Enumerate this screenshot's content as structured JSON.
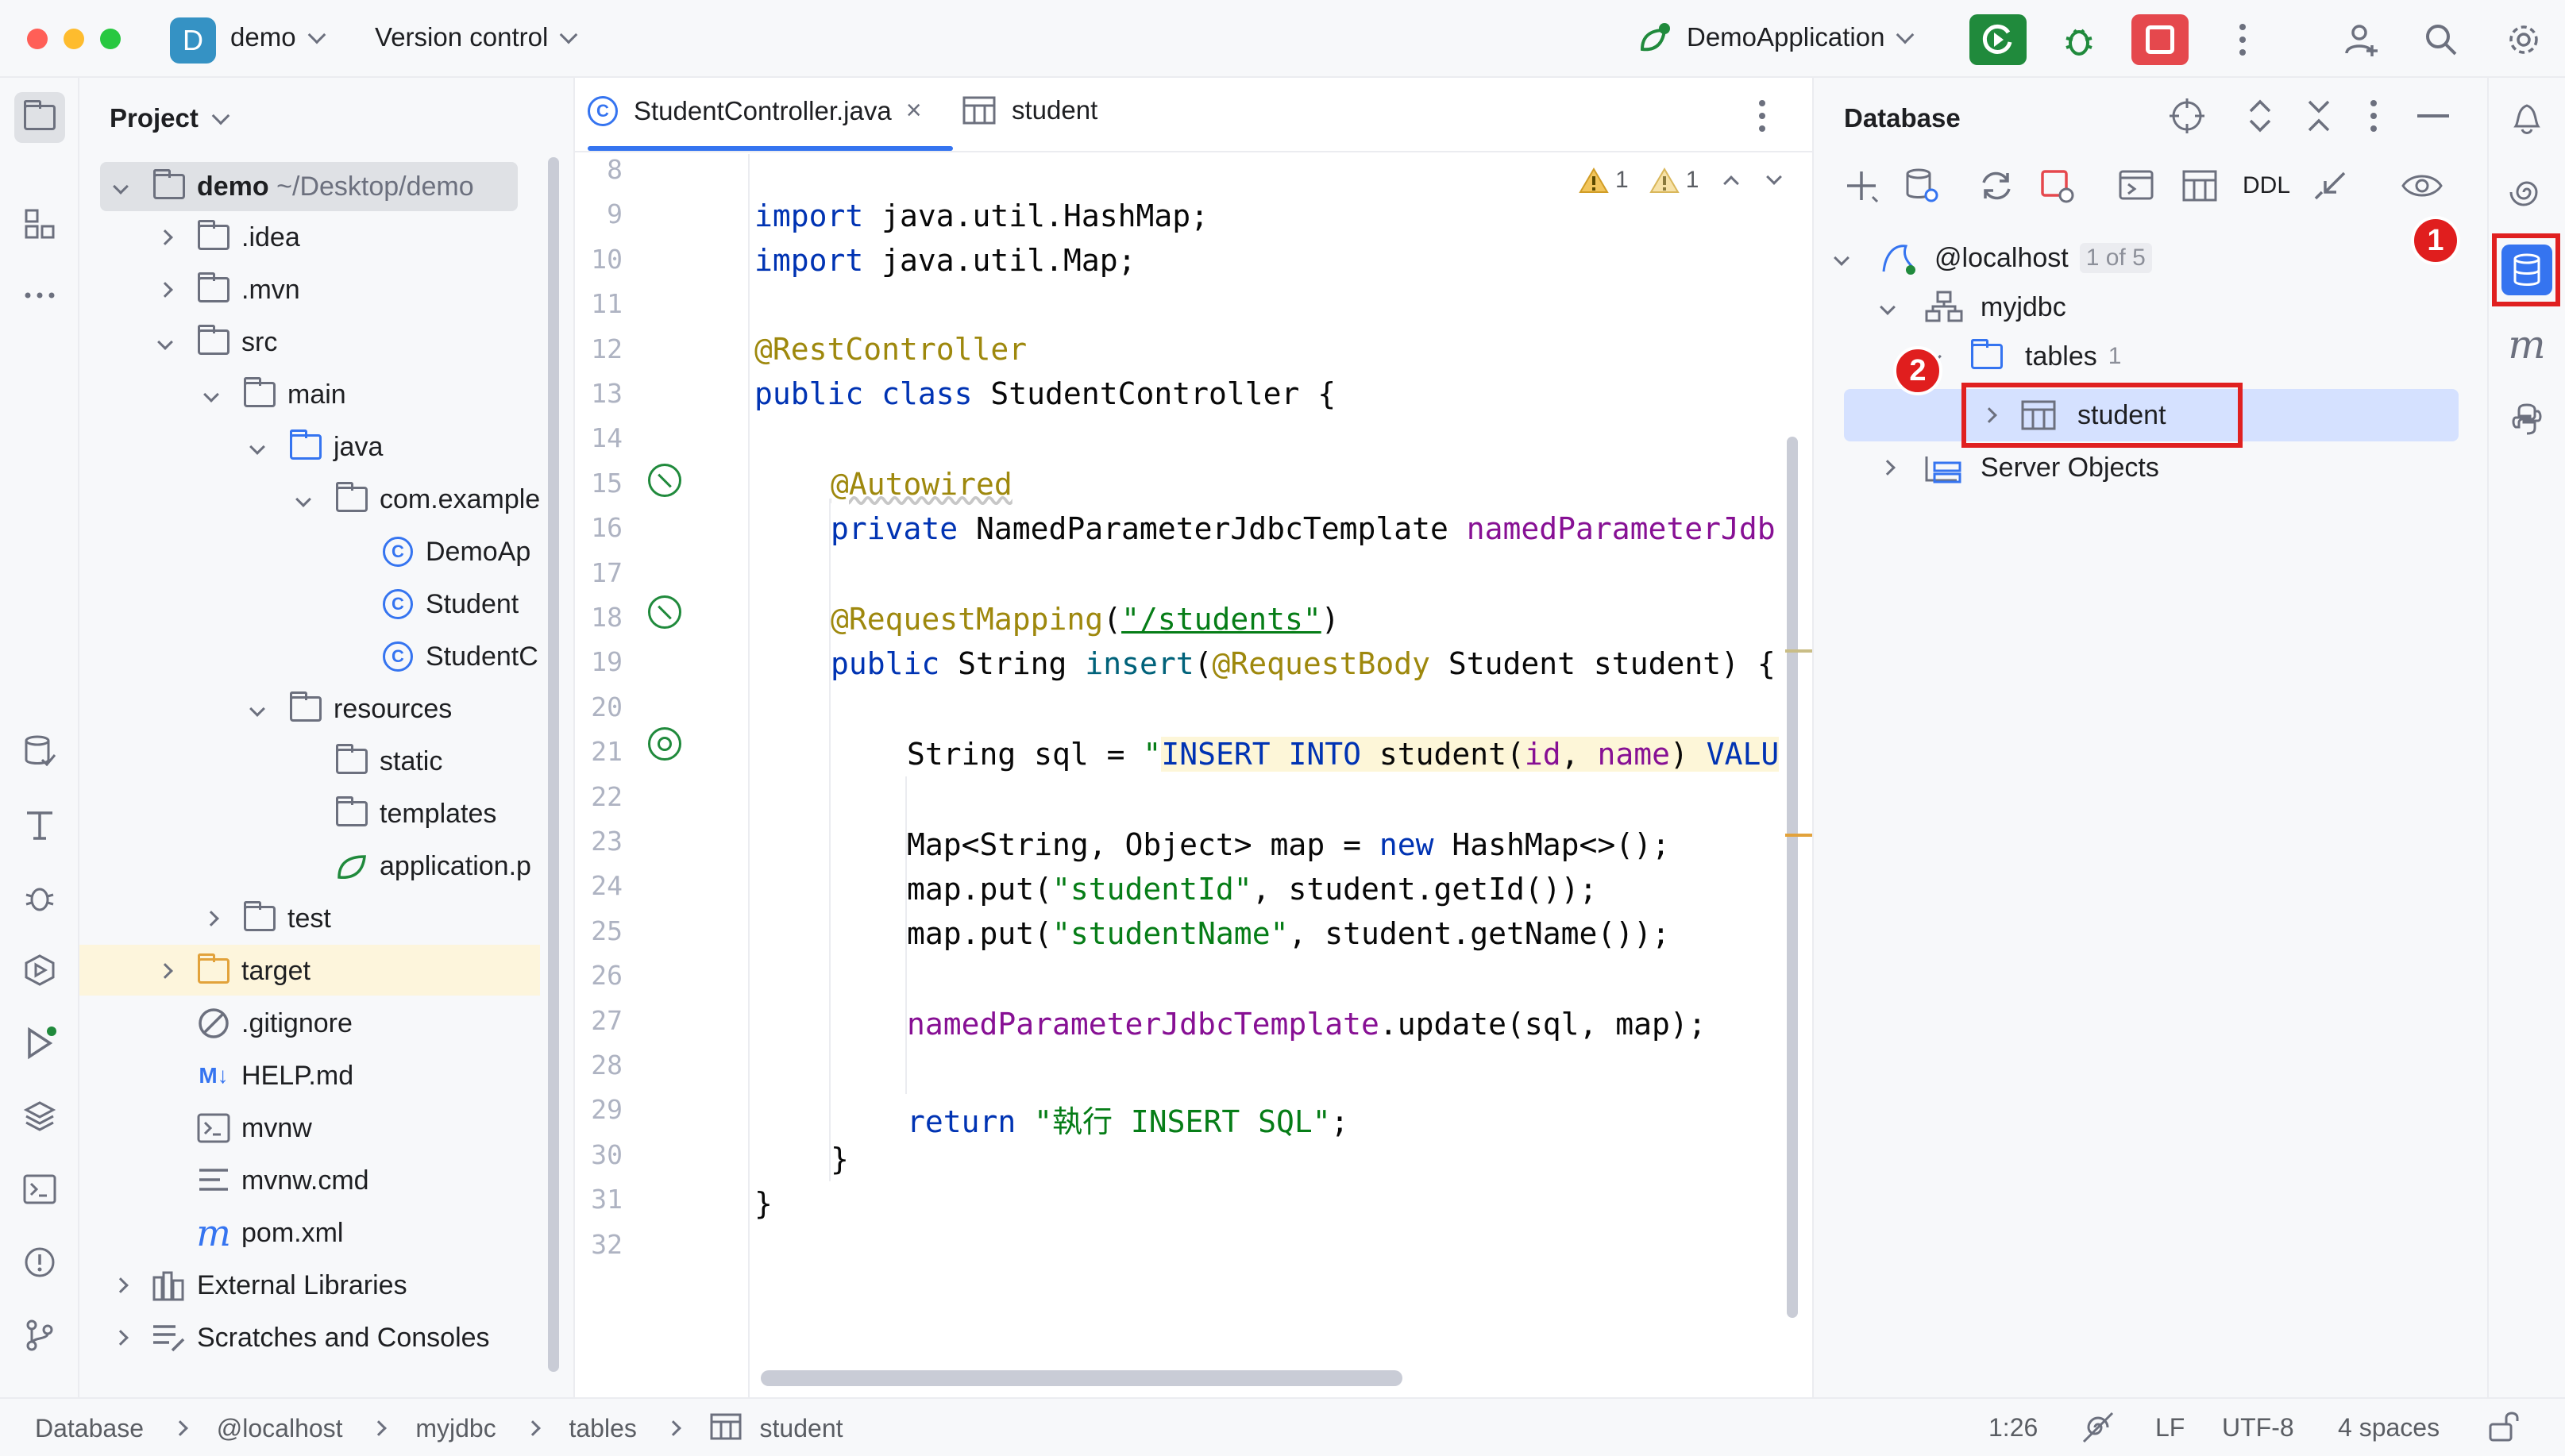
{
  "titlebar": {
    "project_badge": "D",
    "project_name": "demo",
    "vcs_label": "Version control",
    "run_config": "DemoApplication"
  },
  "project_panel": {
    "title": "Project",
    "tree": [
      {
        "label": "demo",
        "suffix": "~/Desktop/demo",
        "kind": "folder"
      },
      {
        "label": ".idea",
        "kind": "folder"
      },
      {
        "label": ".mvn",
        "kind": "folder"
      },
      {
        "label": "src",
        "kind": "folder"
      },
      {
        "label": "main",
        "kind": "folder"
      },
      {
        "label": "java",
        "kind": "folder-blue"
      },
      {
        "label": "com.example",
        "kind": "package"
      },
      {
        "label": "DemoAp",
        "kind": "class-app"
      },
      {
        "label": "Student",
        "kind": "class"
      },
      {
        "label": "StudentC",
        "kind": "class"
      },
      {
        "label": "resources",
        "kind": "folder-res"
      },
      {
        "label": "static",
        "kind": "folder"
      },
      {
        "label": "templates",
        "kind": "folder"
      },
      {
        "label": "application.p",
        "kind": "spring"
      },
      {
        "label": "test",
        "kind": "folder"
      },
      {
        "label": "target",
        "kind": "folder-orange"
      },
      {
        "label": ".gitignore",
        "kind": "ignore"
      },
      {
        "label": "HELP.md",
        "kind": "markdown",
        "icon_text": "M↓"
      },
      {
        "label": "mvnw",
        "kind": "shell"
      },
      {
        "label": "mvnw.cmd",
        "kind": "text"
      },
      {
        "label": "pom.xml",
        "kind": "maven",
        "icon_text": "m"
      },
      {
        "label": "External Libraries",
        "kind": "library"
      },
      {
        "label": "Scratches and Consoles",
        "kind": "scratch"
      }
    ]
  },
  "editor": {
    "tabs": [
      {
        "label": "StudentController.java",
        "active": true
      },
      {
        "label": "student",
        "active": false
      }
    ],
    "inspections": {
      "warnings": "1",
      "weak_warnings": "1"
    },
    "line_numbers": [
      "8",
      "9",
      "10",
      "11",
      "12",
      "13",
      "14",
      "15",
      "16",
      "17",
      "18",
      "19",
      "20",
      "21",
      "22",
      "23",
      "24",
      "25",
      "26",
      "27",
      "28",
      "29",
      "30",
      "31",
      "32"
    ],
    "code": {
      "l9_kw": "import",
      "l9_rest": " java.util.HashMap;",
      "l10_kw": "import",
      "l10_rest": " java.util.Map;",
      "l12": "@RestController",
      "l13_a": "public class",
      "l13_b": " StudentController {",
      "l15": "@Autowired",
      "l16_a": "private",
      "l16_b": " NamedParameterJdbcTemplate ",
      "l16_c": "namedParameterJdb",
      "l18_a": "@RequestMapping",
      "l18_b": "(",
      "l18_c": "\"/students\"",
      "l18_d": ")",
      "l19_a": "public",
      "l19_b": " String ",
      "l19_c": "insert",
      "l19_d": "(",
      "l19_e": "@RequestBody",
      "l19_f": " Student student) {",
      "l21_a": "String sql = ",
      "l21_b": "\"",
      "l21_c": "INSERT INTO",
      "l21_d": " student",
      "l21_e": "(",
      "l21_f": "id",
      "l21_g": ", ",
      "l21_h": "name",
      "l21_i": ") ",
      "l21_j": "VALU",
      "l23_a": "Map<String, Object> map = ",
      "l23_b": "new",
      "l23_c": " HashMap<>();",
      "l24_a": "map.put(",
      "l24_b": "\"studentId\"",
      "l24_c": ", student.getId());",
      "l25_a": "map.put(",
      "l25_b": "\"studentName\"",
      "l25_c": ", student.getName());",
      "l27_a": "namedParameterJdbcTemplate",
      "l27_b": ".update(sql, map);",
      "l29_a": "return",
      "l29_b": " ",
      "l29_c": "\"執行 INSERT SQL\"",
      "l29_d": ";",
      "l30": "}",
      "l31": "}"
    }
  },
  "database_panel": {
    "title": "Database",
    "ddl_label": "DDL",
    "tree": {
      "host": "@localhost",
      "host_badge": "1 of 5",
      "schema": "myjdbc",
      "tables_label": "tables",
      "tables_count": "1",
      "table": "student",
      "server_objects": "Server Objects"
    },
    "annotations": [
      "1",
      "2"
    ]
  },
  "statusbar": {
    "breadcrumbs": [
      "Database",
      "@localhost",
      "myjdbc",
      "tables",
      "student"
    ],
    "position": "1:26",
    "line_sep": "LF",
    "encoding": "UTF-8",
    "indent": "4 spaces"
  },
  "colors": {
    "accent": "#3574f0",
    "annotation_red": "#e02020",
    "run_green": "#208a3c",
    "stop_red": "#e5484d",
    "selection": "#d5e1ff"
  }
}
